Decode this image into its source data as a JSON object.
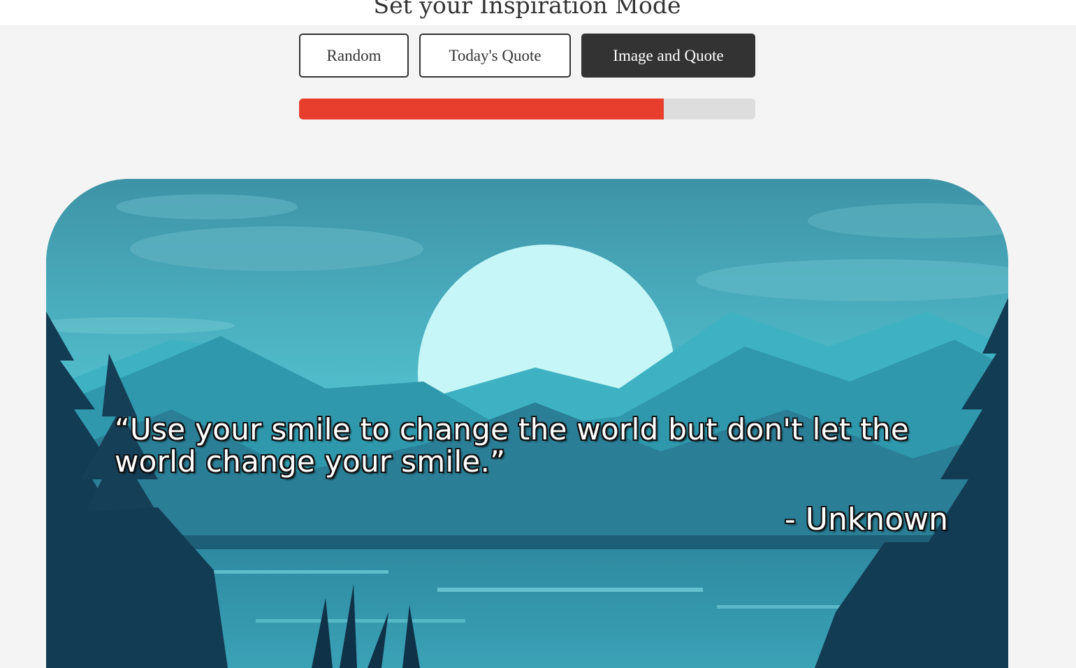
{
  "page": {
    "title": "Set your Inspiration Mode"
  },
  "modes": {
    "random_label": "Random",
    "todays_quote_label": "Today's Quote",
    "image_and_quote_label": "Image and Quote",
    "active": "Image and Quote"
  },
  "progress": {
    "fraction": 0.8,
    "fill_color": "#e83e2e",
    "track_color": "#dddddd"
  },
  "quote_card": {
    "text": "“Use your smile to change the world but don't let the world change your smile.”",
    "author": "- Unknown",
    "image": "mountain-lake-moon-illustration"
  }
}
